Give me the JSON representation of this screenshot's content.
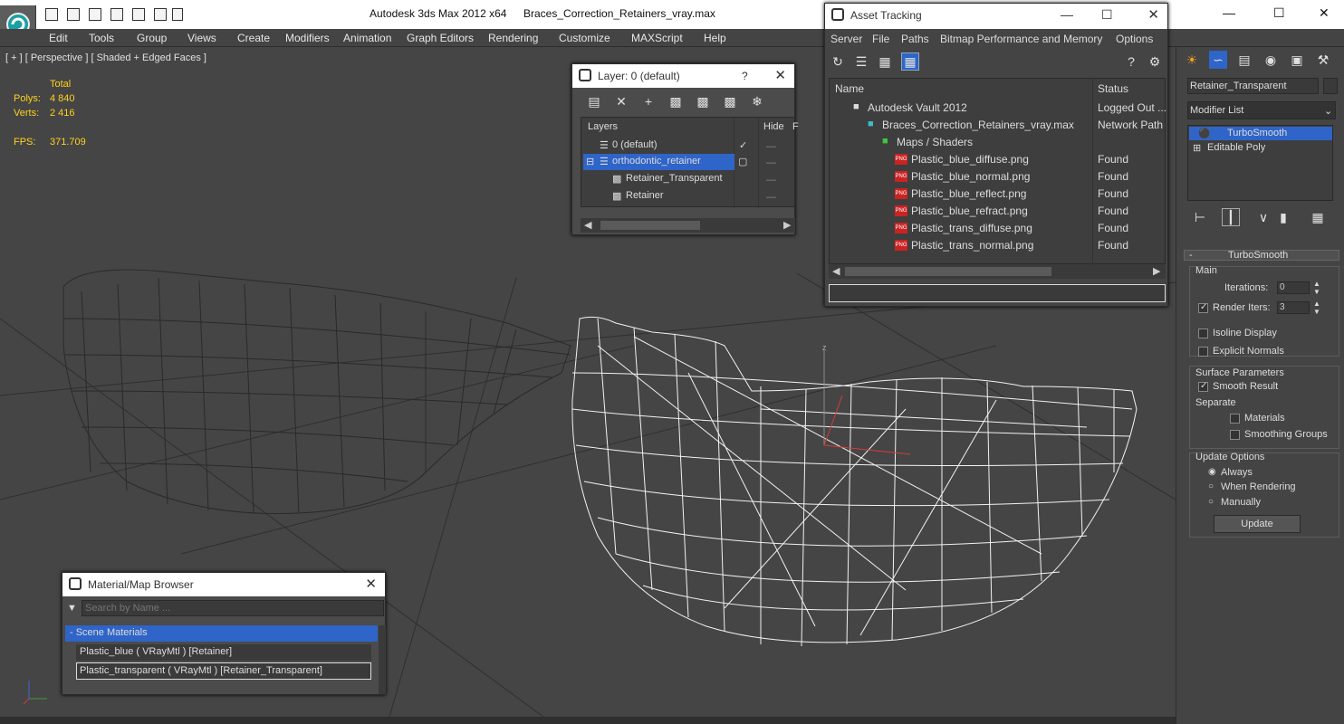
{
  "app": {
    "title": "Autodesk 3ds Max  2012 x64",
    "filename": "Braces_Correction_Retainers_vray.max"
  },
  "menu": [
    "Edit",
    "Tools",
    "Group",
    "Views",
    "Create",
    "Modifiers",
    "Animation",
    "Graph Editors",
    "Rendering",
    "Customize",
    "MAXScript",
    "Help"
  ],
  "viewport": {
    "label": "[ + ] [ Perspective ] [ Shaded + Edged Faces ]",
    "stats": {
      "total_label": "Total",
      "polys_label": "Polys:",
      "polys_value": "4 840",
      "verts_label": "Verts:",
      "verts_value": "2 416",
      "fps_label": "FPS:",
      "fps_value": "371.709"
    },
    "axis_label": "z"
  },
  "layer_panel": {
    "title": "Layer: 0 (default)",
    "help": "?",
    "col_layers": "Layers",
    "col_hide": "Hide",
    "col_f": "F",
    "rows": [
      {
        "name": "0 (default)"
      },
      {
        "name": "orthodontic_retainer"
      },
      {
        "name": "Retainer_Transparent"
      },
      {
        "name": "Retainer"
      }
    ]
  },
  "asset_tracking": {
    "title": "Asset Tracking",
    "menu": [
      "Server",
      "File",
      "Paths",
      "Bitmap Performance and Memory",
      "Options"
    ],
    "col_name": "Name",
    "col_status": "Status",
    "rows": [
      {
        "name": "Autodesk Vault 2012",
        "status": "Logged Out ..."
      },
      {
        "name": "Braces_Correction_Retainers_vray.max",
        "status": "Network Path"
      },
      {
        "name": "Maps / Shaders",
        "status": ""
      },
      {
        "name": "Plastic_blue_diffuse.png",
        "status": "Found"
      },
      {
        "name": "Plastic_blue_normal.png",
        "status": "Found"
      },
      {
        "name": "Plastic_blue_reflect.png",
        "status": "Found"
      },
      {
        "name": "Plastic_blue_refract.png",
        "status": "Found"
      },
      {
        "name": "Plastic_trans_diffuse.png",
        "status": "Found"
      },
      {
        "name": "Plastic_trans_normal.png",
        "status": "Found"
      }
    ],
    "png_badge": "PNG"
  },
  "material_browser": {
    "title": "Material/Map Browser",
    "search_placeholder": "Search by Name ...",
    "group": "- Scene Materials",
    "items": [
      "Plastic_blue  ( VRayMtl ) [Retainer]",
      "Plastic_transparent  ( VRayMtl ) [Retainer_Transparent]"
    ]
  },
  "command_panel": {
    "object_name": "Retainer_Transparent",
    "modifier_list": "Modifier List",
    "stack": [
      "TurboSmooth",
      "Editable Poly"
    ],
    "rollout": "TurboSmooth",
    "main": "Main",
    "iterations_label": "Iterations:",
    "iterations_value": "0",
    "render_iters_label": "Render Iters:",
    "render_iters_value": "3",
    "isoline": "Isoline Display",
    "explicit": "Explicit Normals",
    "surface": "Surface Parameters",
    "smooth": "Smooth Result",
    "separate": "Separate",
    "materials": "Materials",
    "smoothing": "Smoothing Groups",
    "update_options": "Update Options",
    "always": "Always",
    "when_rendering": "When Rendering",
    "manually": "Manually",
    "update_btn": "Update"
  },
  "colors": {
    "selection": "#2f64c8",
    "stat_yellow": "#ffd21e",
    "panel": "#444444"
  }
}
